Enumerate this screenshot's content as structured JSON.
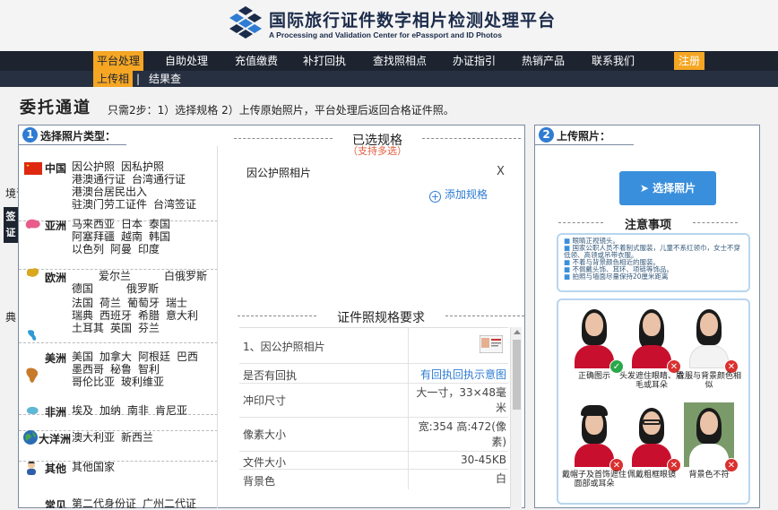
{
  "header": {
    "title": "国际旅行证件数字相片检测处理平台",
    "subtitle": "A Processing and Validation Center for ePassport and ID Photos"
  },
  "nav": {
    "items": [
      "平台处理",
      "自助处理",
      "充值缴费",
      "补打回执",
      "查找照相点",
      "办证指引",
      "热销产品",
      "联系我们"
    ],
    "register": "注册",
    "sub_items": [
      "上传相",
      "结果查"
    ]
  },
  "page": {
    "title": "委托通道",
    "desc": "只需2步：1）选择规格 2）上传原始照片，平台处理后返回合格证件照。"
  },
  "step1": {
    "num": "1",
    "label": "选择照片类型：",
    "categories": [
      {
        "name": "中国",
        "items": [
          "因公护照",
          "因私护照",
          "港澳通行证",
          "台湾通行证",
          "港澳台居民出入",
          "驻澳门劳工证件",
          "台湾签证"
        ]
      },
      {
        "name": "亚洲",
        "items": [
          "马来西亚",
          "日本",
          "泰国",
          "阿塞拜疆",
          "越南",
          "韩国",
          "以色列",
          "阿曼",
          "印度"
        ]
      },
      {
        "name": "欧洲",
        "items": [
          "爱尔兰",
          "白俄罗斯",
          "德国",
          "俄罗斯",
          "法国",
          "荷兰",
          "葡萄牙",
          "瑞士",
          "瑞典",
          "西班牙",
          "希腊",
          "意大利",
          "土耳其",
          "英国",
          "芬兰"
        ]
      },
      {
        "name": "美洲",
        "items": [
          "美国",
          "加拿大",
          "阿根廷",
          "巴西",
          "墨西哥",
          "秘鲁",
          "智利",
          "哥伦比亚",
          "玻利维亚"
        ]
      },
      {
        "name": "非洲",
        "items": [
          "埃及",
          "加纳",
          "南非",
          "肯尼亚"
        ]
      },
      {
        "name": "大洋洲",
        "items": [
          "澳大利亚",
          "新西兰"
        ]
      },
      {
        "name": "其他",
        "items": [
          "其他国家"
        ]
      },
      {
        "name": "常见",
        "items": [
          "第二代身份证",
          "广州二代证"
        ]
      }
    ],
    "float_text_1": "境证件",
    "float_tab": "签证",
    "float_text_2": "典"
  },
  "selected": {
    "title": "已选规格",
    "hint": "（支持多选）",
    "item": "因公护照相片",
    "remove": "X",
    "add_label": "添加规格",
    "add_icon": "+"
  },
  "requirements": {
    "title": "证件照规格要求",
    "rows": [
      {
        "k": "1、因公护照相片",
        "v": ""
      },
      {
        "k": "是否有回执",
        "v": "有回执回执示意图"
      },
      {
        "k": "冲印尺寸",
        "v": "大一寸，33×48毫米"
      },
      {
        "k": "像素大小",
        "v": "宽:354 高:472(像素)"
      },
      {
        "k": "文件大小",
        "v": "30-45KB"
      },
      {
        "k": "背景色",
        "v": "白"
      }
    ]
  },
  "step2": {
    "num": "2",
    "label": "上传照片：",
    "upload_button": "选择照片",
    "notice_title": "注意事项",
    "notices": [
      "眼睛正视镜头。",
      "国家公职人员不着制式服装，儿童不系红领巾，女士不穿低领、高领或吊带衣服。",
      "不着与背景颜色相近的服装。",
      "不佩戴头饰、耳环、项链等饰品。",
      "拍照与墙面尽量保持20厘米距离"
    ],
    "examples": [
      {
        "caption": "正确图示",
        "status": "ok",
        "mark": "✓"
      },
      {
        "caption": "头发遮住眼睛、眉毛或耳朵",
        "status": "bad",
        "mark": "✕"
      },
      {
        "caption": "衣服与背景颜色相似",
        "status": "bad",
        "mark": "✕"
      },
      {
        "caption": "戴帽子及首饰遮住面部或耳朵",
        "status": "bad",
        "mark": "✕"
      },
      {
        "caption": "佩戴粗框眼镜",
        "status": "bad",
        "mark": "✕"
      },
      {
        "caption": "背景色不符",
        "status": "bad",
        "mark": "✕"
      }
    ]
  },
  "colors": {
    "accent": "#f5a623",
    "nav_bg": "#1d2430",
    "link_blue": "#2f7cd3",
    "hint_red": "#e25a3c"
  }
}
